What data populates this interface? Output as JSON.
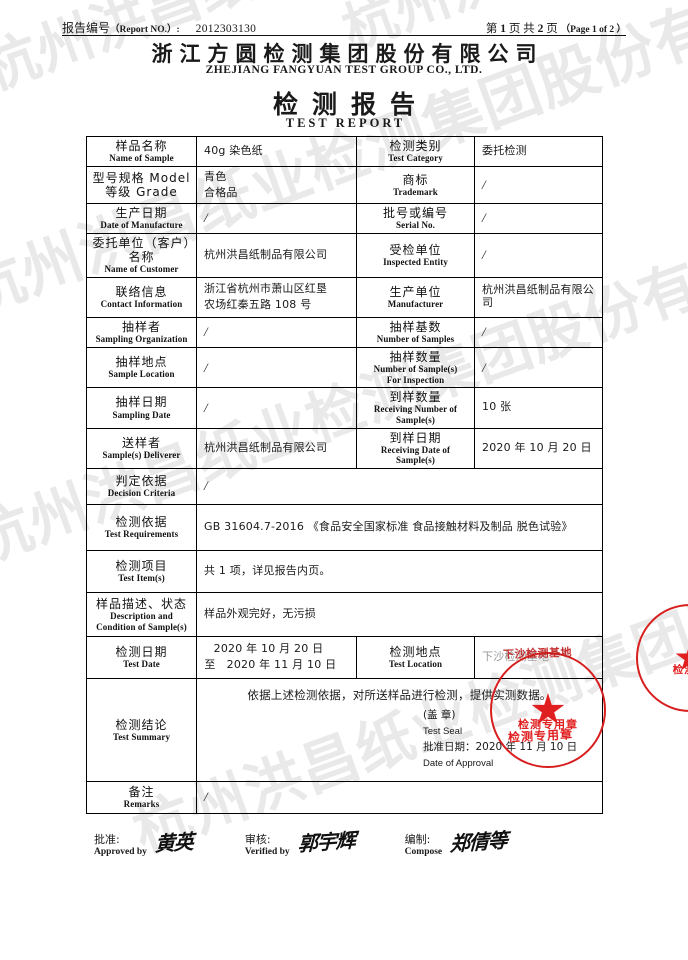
{
  "header": {
    "report_no_cn": "报告编号",
    "report_no_en": "（Report NO.）:",
    "report_no_value": "2012303130",
    "page_prefix_cn": "第",
    "page_current": "1",
    "page_mid_cn": "页 共",
    "page_total": "2",
    "page_suffix_cn": "页",
    "page_en": "（Page 1 of 2 ）",
    "company_cn": "浙江方圆检测集团股份有限公司",
    "company_en": "ZHEJIANG  FANGYUAN  TEST  GROUP  CO.,  LTD.",
    "title_cn": "检测报告",
    "title_en": "TEST REPORT"
  },
  "table": {
    "rows": [
      {
        "label_cn": "样品名称",
        "label_en": "Name of Sample",
        "value": "40g 染色纸",
        "label2_cn": "检测类别",
        "label2_en": "Test Category",
        "value2": "委托检测"
      },
      {
        "label_cn": "型号规格 Model",
        "label_en": "等级 Grade",
        "value": "青色",
        "value_line2": "合格品",
        "label2_cn": "商标",
        "label2_en": "Trademark",
        "value2": "/"
      },
      {
        "label_cn": "生产日期",
        "label_en": "Date of Manufacture",
        "value": "/",
        "label2_cn": "批号或编号",
        "label2_en": "Serial No.",
        "value2": "/"
      },
      {
        "label_cn": "委托单位（客户）名称",
        "label_en": "Name of Customer",
        "value": "杭州洪昌纸制品有限公司",
        "label2_cn": "受检单位",
        "label2_en": "Inspected Entity",
        "value2": "/"
      },
      {
        "label_cn": "联络信息",
        "label_en": "Contact Information",
        "value": "浙江省杭州市萧山区红垦",
        "value_line2": "农场红秦五路 108 号",
        "label2_cn": "生产单位",
        "label2_en": "Manufacturer",
        "value2": "杭州洪昌纸制品有限公司"
      },
      {
        "label_cn": "抽样者",
        "label_en": "Sampling Organization",
        "value": "/",
        "label2_cn": "抽样基数",
        "label2_en": "Number of Samples",
        "value2": "/"
      },
      {
        "label_cn": "抽样地点",
        "label_en": "Sample Location",
        "value": "/",
        "label2_cn": "抽样数量",
        "label2_en": "Number of Sample(s)",
        "label2_en2": "For Inspection",
        "value2": "/"
      },
      {
        "label_cn": "抽样日期",
        "label_en": "Sampling Date",
        "value": "/",
        "label2_cn": "到样数量",
        "label2_en": "Receiving Number of",
        "label2_en2": "Sample(s)",
        "value2": "10 张"
      },
      {
        "label_cn": "送样者",
        "label_en": "Sample(s) Deliverer",
        "value": "杭州洪昌纸制品有限公司",
        "label2_cn": "到样日期",
        "label2_en": "Receiving Date of",
        "label2_en2": "Sample(s)",
        "value2": "2020 年 10 月 20 日"
      }
    ],
    "decision": {
      "label_cn": "判定依据",
      "label_en": "Decision Criteria",
      "value": "/"
    },
    "requirements": {
      "label_cn": "检测依据",
      "label_en": "Test Requirements",
      "value": "GB 31604.7-2016 《食品安全国家标准 食品接触材料及制品 脱色试验》"
    },
    "items": {
      "label_cn": "检测项目",
      "label_en": "Test Item(s)",
      "value": "共 1 项，详见报告内页。"
    },
    "description": {
      "label_cn": "样品描述、状态",
      "label_en": "Description and",
      "label_en2": "Condition of Sample(s)",
      "value": "样品外观完好，无污损"
    },
    "test_date": {
      "label_cn": "检测日期",
      "label_en": "Test Date",
      "date_from": "2020 年 10 月 20 日",
      "zhi": "至",
      "date_to": "2020 年 11 月 10 日",
      "label2_cn": "检测地点",
      "label2_en": "Test Location",
      "value2": "下沙检测基地"
    },
    "summary": {
      "label_cn": "检测结论",
      "label_en": "Test Summary",
      "text": "依据上述检测依据，对所送样品进行检测，提供实测数据。",
      "seal_cn": "(盖 章)",
      "seal_en": "Test Seal",
      "approval_cn": "批准日期：2020 年 11 月 10 日",
      "approval_en": "Date of Approval"
    },
    "remarks": {
      "label_cn": "备注",
      "label_en": "Remarks",
      "value": "/"
    }
  },
  "signatures": [
    {
      "label_cn": "批准:",
      "label_en": "Approved by",
      "name": "黄英"
    },
    {
      "label_cn": "审核:",
      "label_en": "Verified by",
      "name": "郭宇辉"
    },
    {
      "label_cn": "编制:",
      "label_en": "Compose",
      "name": "郑倩等"
    }
  ],
  "seals": {
    "main_color": "#d81f1f",
    "main_text_bottom": "检测专用章",
    "edge_text_bottom": "检测专",
    "location_stamp": "下沙检测基地",
    "approval_stamp": "检测专用章"
  },
  "watermark": {
    "text": "杭州洪昌纸业检测集团股份有限公司",
    "color": "#e9e9e9"
  }
}
